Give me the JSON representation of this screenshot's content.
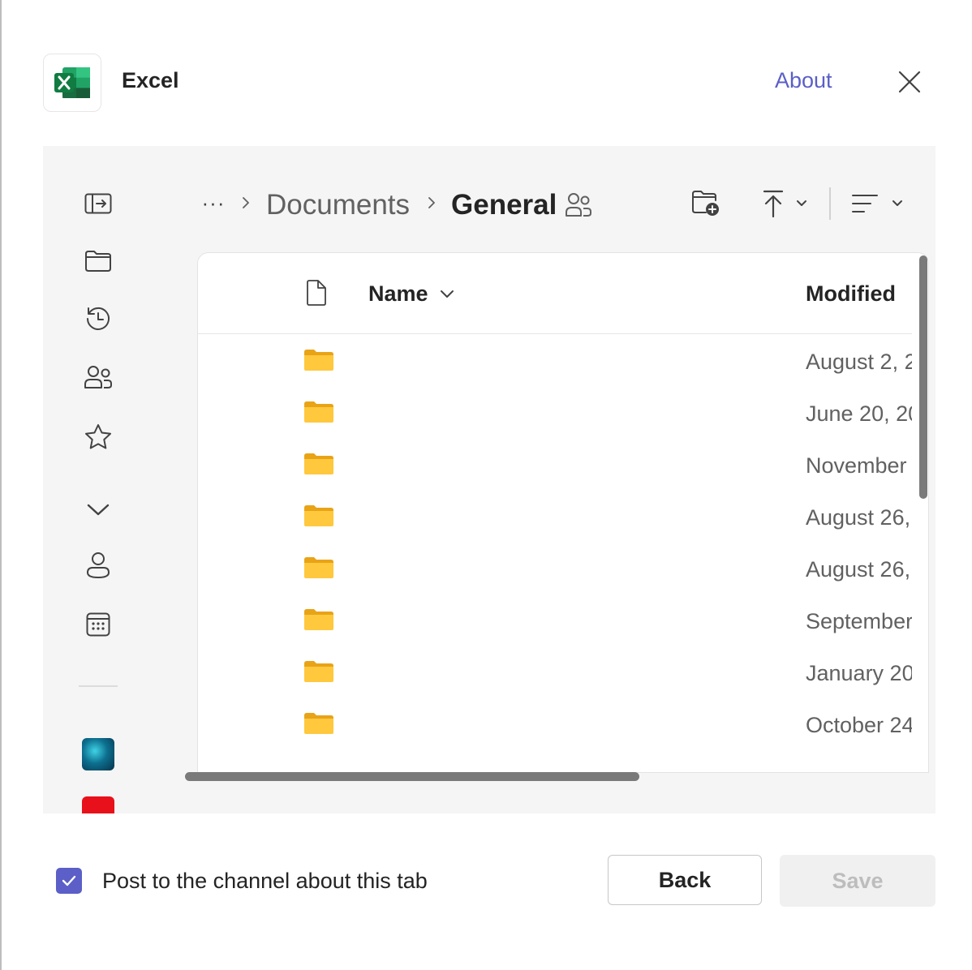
{
  "header": {
    "app_name": "Excel",
    "app_icon": "excel-logo",
    "about_label": "About",
    "close_icon": "close-icon"
  },
  "rail": {
    "items": [
      {
        "name": "open-in-icon"
      },
      {
        "name": "my-files-icon"
      },
      {
        "name": "recent-icon"
      },
      {
        "name": "shared-icon"
      },
      {
        "name": "favorites-icon"
      },
      {
        "name": "expand-chevron-icon"
      },
      {
        "name": "person-icon"
      },
      {
        "name": "calendar-icon"
      }
    ],
    "apps": [
      {
        "name": "app-tile-blue"
      },
      {
        "name": "app-tile-red"
      }
    ]
  },
  "breadcrumb": {
    "more": "···",
    "items": [
      "Documents",
      "General"
    ]
  },
  "toolbar": {
    "new_folder_icon": "folder-add-icon",
    "sort_icon": "sort-up-icon",
    "view_icon": "view-options-icon"
  },
  "list": {
    "columns": {
      "name": "Name",
      "modified": "Modified"
    },
    "rows": [
      {
        "modified": "August 2, 2"
      },
      {
        "modified": "June 20, 20"
      },
      {
        "modified": "November"
      },
      {
        "modified": "August 26,"
      },
      {
        "modified": "August 26,"
      },
      {
        "modified": "September"
      },
      {
        "modified": "January 20"
      },
      {
        "modified": "October 24"
      }
    ]
  },
  "footer": {
    "post_label": "Post to the channel about this tab",
    "post_checked": true,
    "back_label": "Back",
    "save_label": "Save"
  },
  "colors": {
    "accent": "#5b5fc7",
    "excel_green": "#107c41",
    "folder_yellow": "#ffc83d"
  }
}
